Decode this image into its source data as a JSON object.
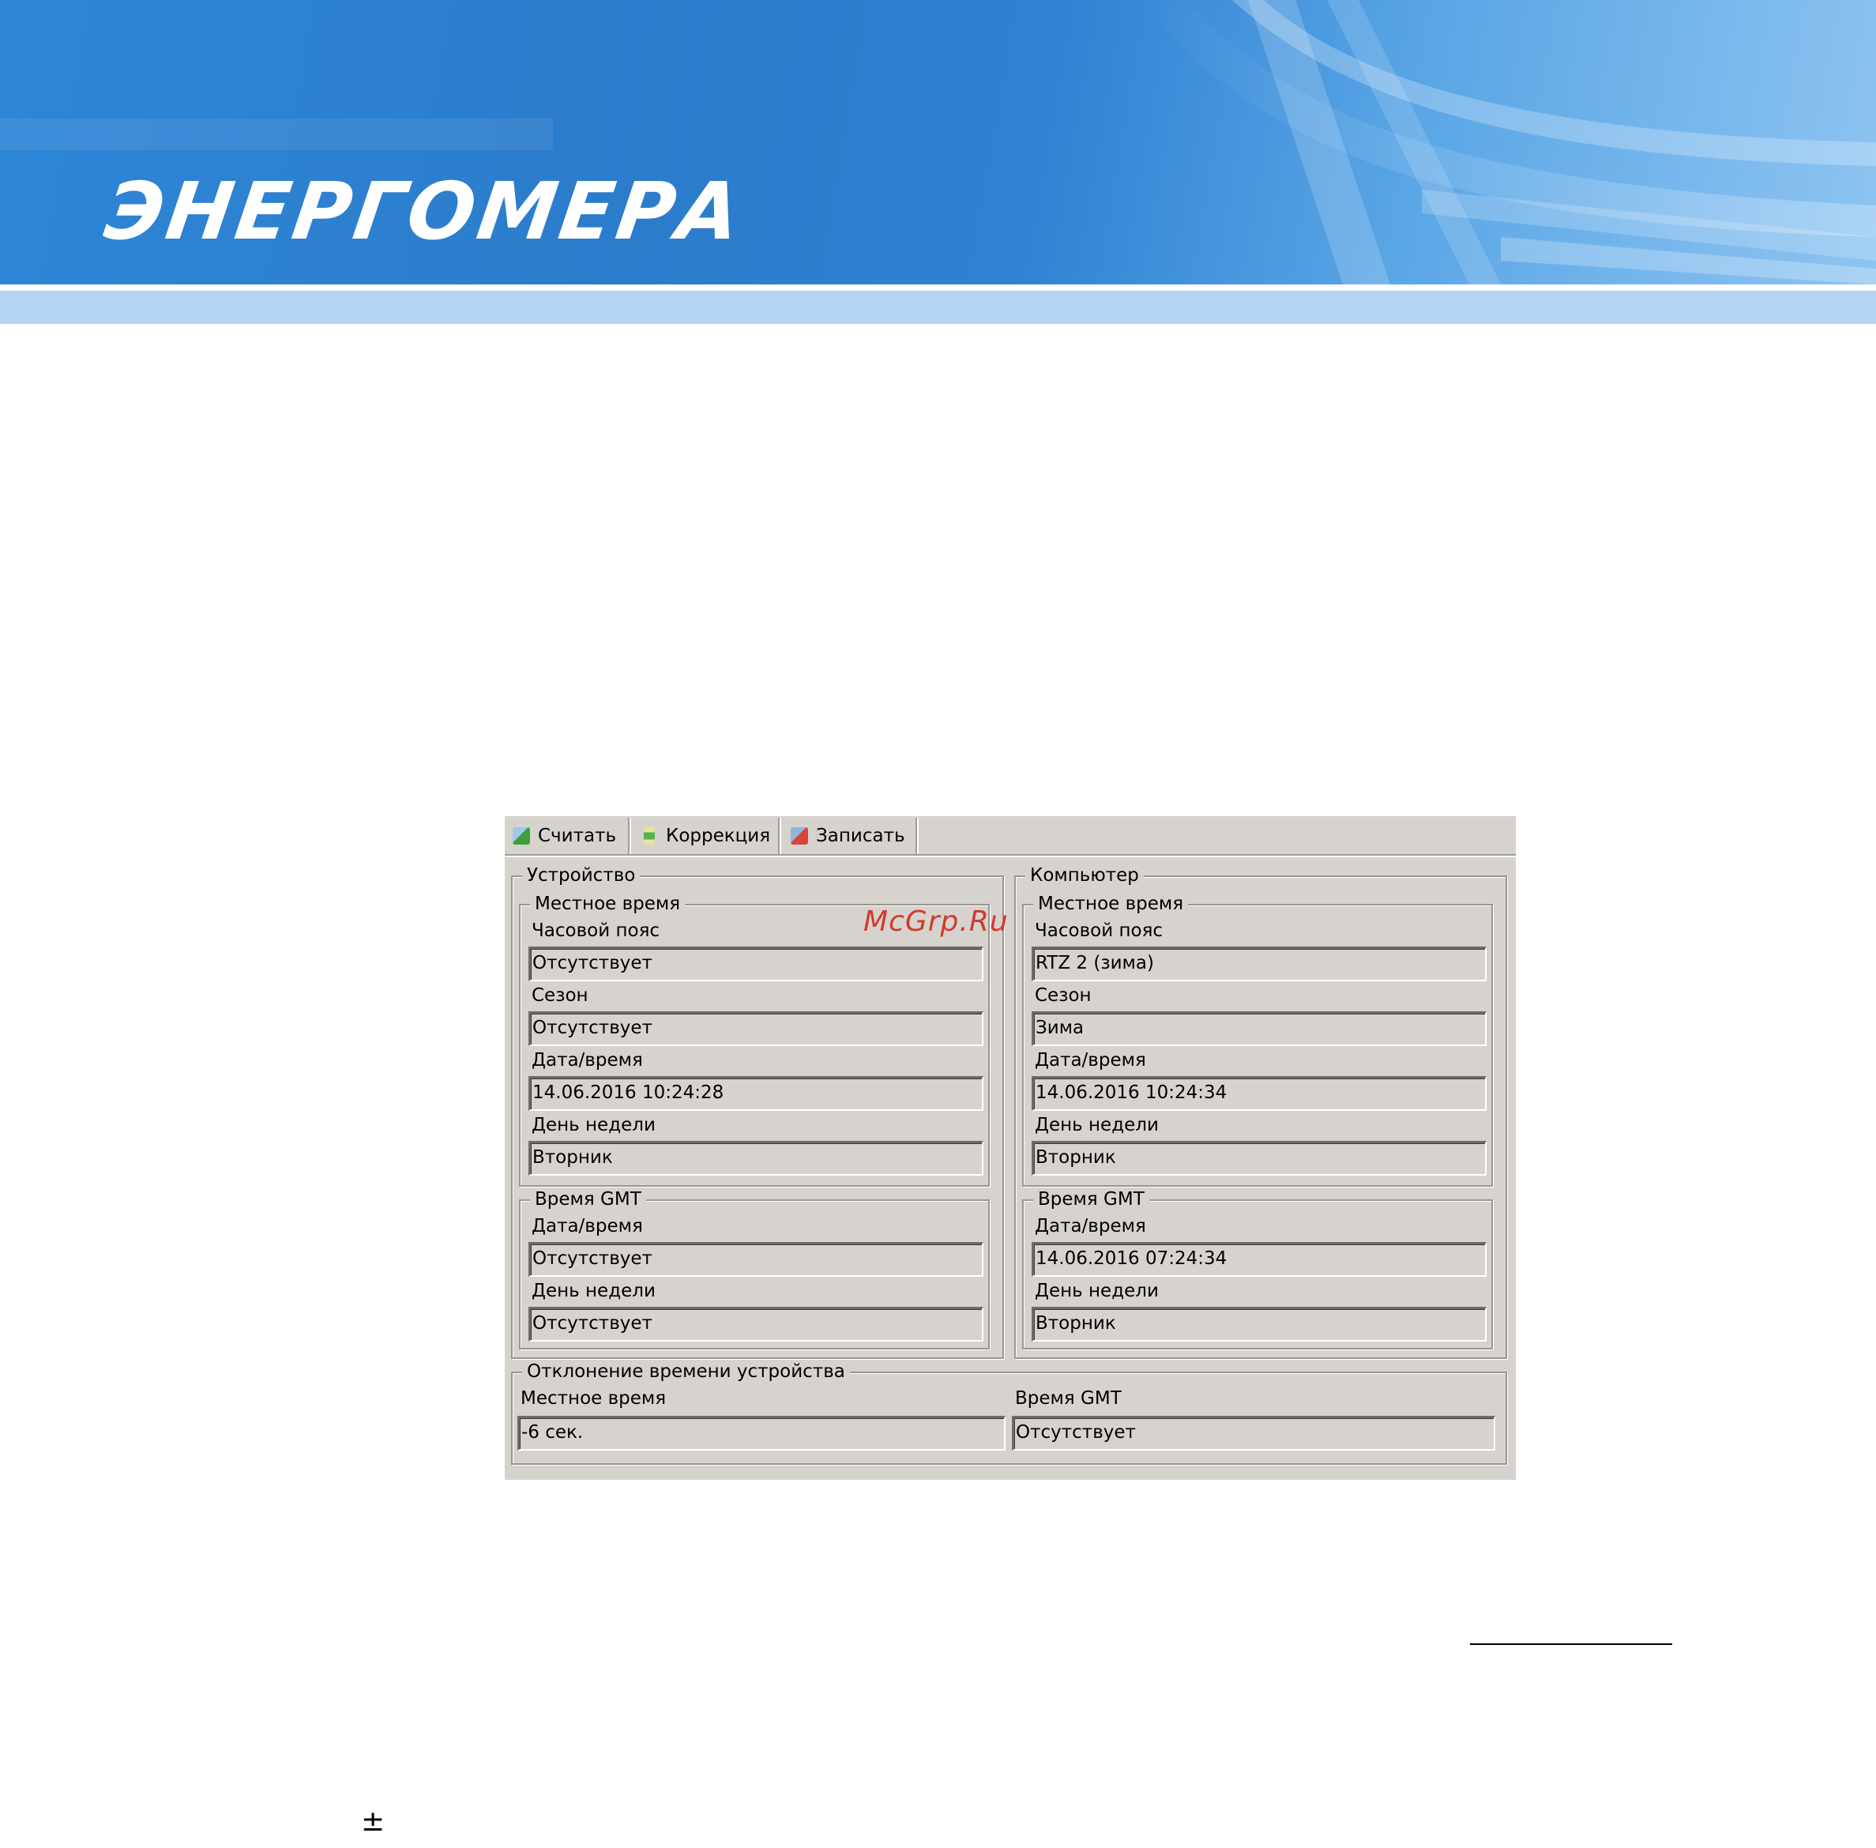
{
  "banner": {
    "logo_text": "ЭНЕРГОМЕРА"
  },
  "colors": {
    "banner_blue": "#2f86d6",
    "banner_light": "#b4d4f4",
    "window_bg": "#d6d3ce",
    "watermark_red": "#d23a2e"
  },
  "toolbar": {
    "read_label": "Считать",
    "read_icon": "read-icon",
    "correction_label": "Коррекция",
    "correction_icon": "correction-icon",
    "write_label": "Записать",
    "write_icon": "write-icon"
  },
  "device": {
    "title": "Устройство",
    "local": {
      "title": "Местное время",
      "timezone_label": "Часовой пояс",
      "timezone_value": "Отсутствует",
      "season_label": "Сезон",
      "season_value": "Отсутствует",
      "datetime_label": "Дата/время",
      "datetime_value": "14.06.2016 10:24:28",
      "weekday_label": "День недели",
      "weekday_value": "Вторник"
    },
    "gmt": {
      "title": "Время GMT",
      "datetime_label": "Дата/время",
      "datetime_value": "Отсутствует",
      "weekday_label": "День недели",
      "weekday_value": "Отсутствует"
    }
  },
  "computer": {
    "title": "Компьютер",
    "local": {
      "title": "Местное время",
      "timezone_label": "Часовой пояс",
      "timezone_value": "RTZ 2 (зима)",
      "season_label": "Сезон",
      "season_value": "Зима",
      "datetime_label": "Дата/время",
      "datetime_value": "14.06.2016 10:24:34",
      "weekday_label": "День недели",
      "weekday_value": "Вторник"
    },
    "gmt": {
      "title": "Время GMT",
      "datetime_label": "Дата/время",
      "datetime_value": "14.06.2016 07:24:34",
      "weekday_label": "День недели",
      "weekday_value": "Вторник"
    }
  },
  "deviation": {
    "title": "Отклонение времени устройства",
    "local_label": "Местное время",
    "local_value": "-6 сек.",
    "gmt_label": "Время GMT",
    "gmt_value": "Отсутствует"
  },
  "watermark": "McGrp.Ru",
  "footer": {
    "plus_minus": "±"
  }
}
